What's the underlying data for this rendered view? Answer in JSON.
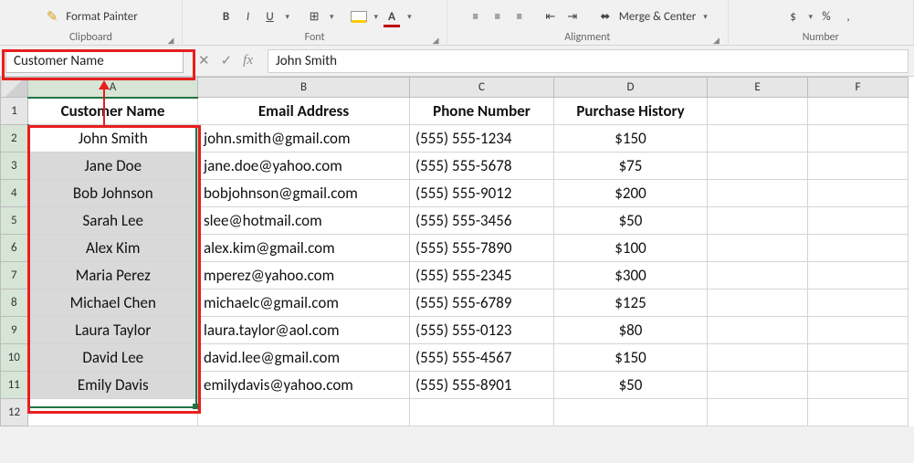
{
  "ribbon": {
    "clipboard": {
      "format_painter": "Format Painter",
      "label": "Clipboard"
    },
    "font": {
      "label": "Font",
      "bold": "B",
      "italic": "I",
      "underline": "U"
    },
    "alignment": {
      "label": "Alignment",
      "merge": "Merge & Center"
    },
    "number": {
      "label": "Number",
      "percent": "%",
      "comma": ","
    }
  },
  "name_box": "Customer Name",
  "formula_bar": {
    "value": "John Smith",
    "fx": "fx"
  },
  "columns": [
    "A",
    "B",
    "C",
    "D",
    "E",
    "F"
  ],
  "active_column": "A",
  "active_rows_start": 2,
  "active_rows_end": 11,
  "headers": [
    "Customer Name",
    "Email Address",
    "Phone Number",
    "Purchase History"
  ],
  "rows": [
    {
      "name": "John Smith",
      "email": "john.smith@gmail.com",
      "phone": "(555) 555-1234",
      "purchase": "$150"
    },
    {
      "name": "Jane Doe",
      "email": "jane.doe@yahoo.com",
      "phone": "(555) 555-5678",
      "purchase": "$75"
    },
    {
      "name": "Bob Johnson",
      "email": "bobjohnson@gmail.com",
      "phone": "(555) 555-9012",
      "purchase": "$200"
    },
    {
      "name": "Sarah Lee",
      "email": "slee@hotmail.com",
      "phone": "(555) 555-3456",
      "purchase": "$50"
    },
    {
      "name": "Alex Kim",
      "email": "alex.kim@gmail.com",
      "phone": "(555) 555-7890",
      "purchase": "$100"
    },
    {
      "name": "Maria Perez",
      "email": "mperez@yahoo.com",
      "phone": "(555) 555-2345",
      "purchase": "$300"
    },
    {
      "name": "Michael Chen",
      "email": "michaelc@gmail.com",
      "phone": "(555) 555-6789",
      "purchase": "$125"
    },
    {
      "name": "Laura Taylor",
      "email": "laura.taylor@aol.com",
      "phone": "(555) 555-0123",
      "purchase": "$80"
    },
    {
      "name": "David Lee",
      "email": "david.lee@gmail.com",
      "phone": "(555) 555-4567",
      "purchase": "$150"
    },
    {
      "name": "Emily Davis",
      "email": "emilydavis@yahoo.com",
      "phone": "(555) 555-8901",
      "purchase": "$50"
    }
  ],
  "last_row_number": 12
}
